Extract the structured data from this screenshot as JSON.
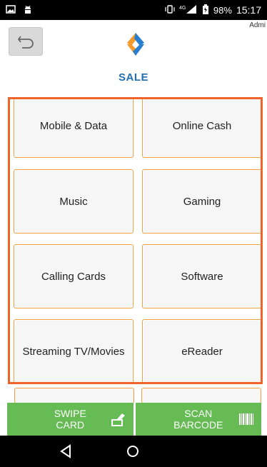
{
  "status_bar": {
    "battery": "98%",
    "time": "15:17",
    "network": "4G",
    "icons": [
      "gallery-icon",
      "android-icon",
      "vibrate-icon",
      "signal-icon",
      "battery-icon"
    ]
  },
  "header": {
    "user": "Admi",
    "title": "SALE",
    "back_icon": "back-arrow-icon",
    "logo": "brand-logo"
  },
  "categories": [
    {
      "label": "Mobile & Data"
    },
    {
      "label": "Online Cash"
    },
    {
      "label": "Music"
    },
    {
      "label": "Gaming"
    },
    {
      "label": "Calling Cards"
    },
    {
      "label": "Software"
    },
    {
      "label": "Streaming TV/Movies"
    },
    {
      "label": "eReader"
    }
  ],
  "actions": {
    "swipe": {
      "line1": "SWIPE",
      "line2": "CARD",
      "icon": "card-swipe-icon"
    },
    "scan": {
      "line1": "SCAN",
      "line2": "BARCODE",
      "icon": "barcode-icon"
    }
  },
  "nav": {
    "back_icon": "nav-back-icon",
    "home_icon": "nav-home-icon"
  },
  "colors": {
    "accent_border": "#f0642b",
    "tile_border": "#f0a040",
    "title_blue": "#1f6fb2",
    "action_green": "#66bb55",
    "logo_orange": "#f39a2b",
    "logo_blue": "#2a7ed0"
  }
}
